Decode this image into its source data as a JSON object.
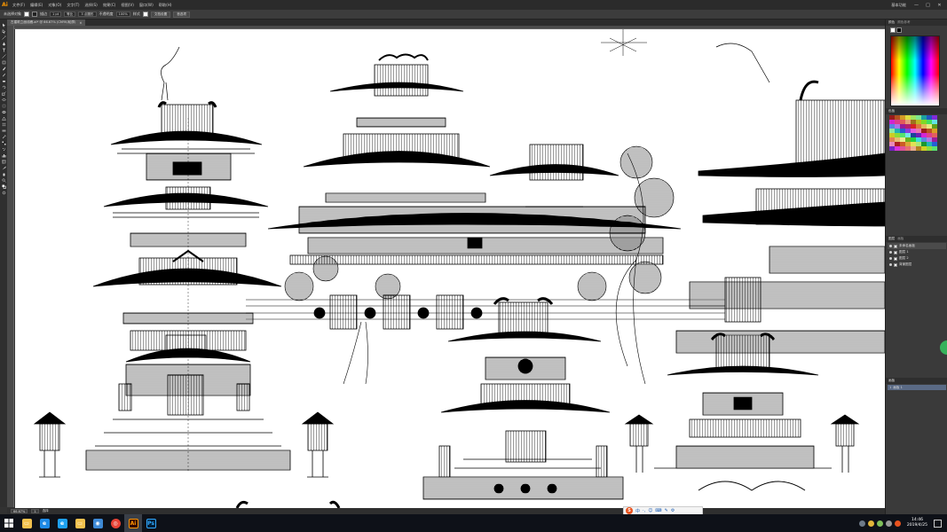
{
  "app": {
    "logo": "Ai",
    "window_controls": [
      "—",
      "□",
      "✕"
    ],
    "workspace": "基本功能"
  },
  "menu": [
    "文件(F)",
    "编辑(E)",
    "对象(O)",
    "文字(T)",
    "选择(S)",
    "效果(C)",
    "视图(V)",
    "窗口(W)",
    "帮助(H)"
  ],
  "control_bar": {
    "selection": "未选择对象",
    "stroke_label": "描边",
    "stroke_value": "1 pt",
    "line_style": "等比",
    "brush": "3 点圆形",
    "opacity_label": "不透明度",
    "opacity_value": "100%",
    "style_label": "样式",
    "doc_setup": "文档设置",
    "preferences": "首选项"
  },
  "document_tab": {
    "label": "古建筑立面线稿.ai* @ 66.67% (CMYK/轮廓)",
    "close": "✕"
  },
  "status_bar": {
    "zoom": "66.67%",
    "artboard": "1",
    "tool": "选择"
  },
  "panels": {
    "color_tabs": [
      "颜色",
      "颜色参考"
    ],
    "swatch_tab": "色板",
    "layer_tabs": [
      "图层",
      "画板"
    ],
    "layers": [
      {
        "name": "未命名画板"
      },
      {
        "name": "图层 1"
      },
      {
        "name": "图层 2"
      },
      {
        "name": "背景图层"
      }
    ],
    "artboard_tab": "画板",
    "artboards": [
      {
        "index": "1",
        "name": "画板 1"
      }
    ]
  },
  "ime": {
    "logo": "S",
    "items": [
      "中",
      "·,",
      "☺",
      "⌨",
      "✎",
      "⚙"
    ]
  },
  "taskbar": {
    "apps": [
      {
        "name": "file-explorer",
        "glyph": "▭",
        "color": "#f2c14e"
      },
      {
        "name": "edge",
        "glyph": "e",
        "color": "#1e8ae6"
      },
      {
        "name": "ie",
        "glyph": "e",
        "color": "#1ea1f2"
      },
      {
        "name": "folder",
        "glyph": "▭",
        "color": "#f2c14e"
      },
      {
        "name": "camera",
        "glyph": "◉",
        "color": "#3d89d6"
      },
      {
        "name": "chrome",
        "glyph": "◎",
        "color": "#e94235"
      },
      {
        "name": "illustrator",
        "glyph": "Ai",
        "color": "#ff9a00"
      },
      {
        "name": "photoshop",
        "glyph": "Ps",
        "color": "#31a8ff"
      }
    ],
    "time": "14:46",
    "date": "2019/4/25"
  },
  "colors": {
    "accent": "#ff9a00",
    "panel_bg": "#3a3a3a",
    "canvas": "#ffffff"
  }
}
